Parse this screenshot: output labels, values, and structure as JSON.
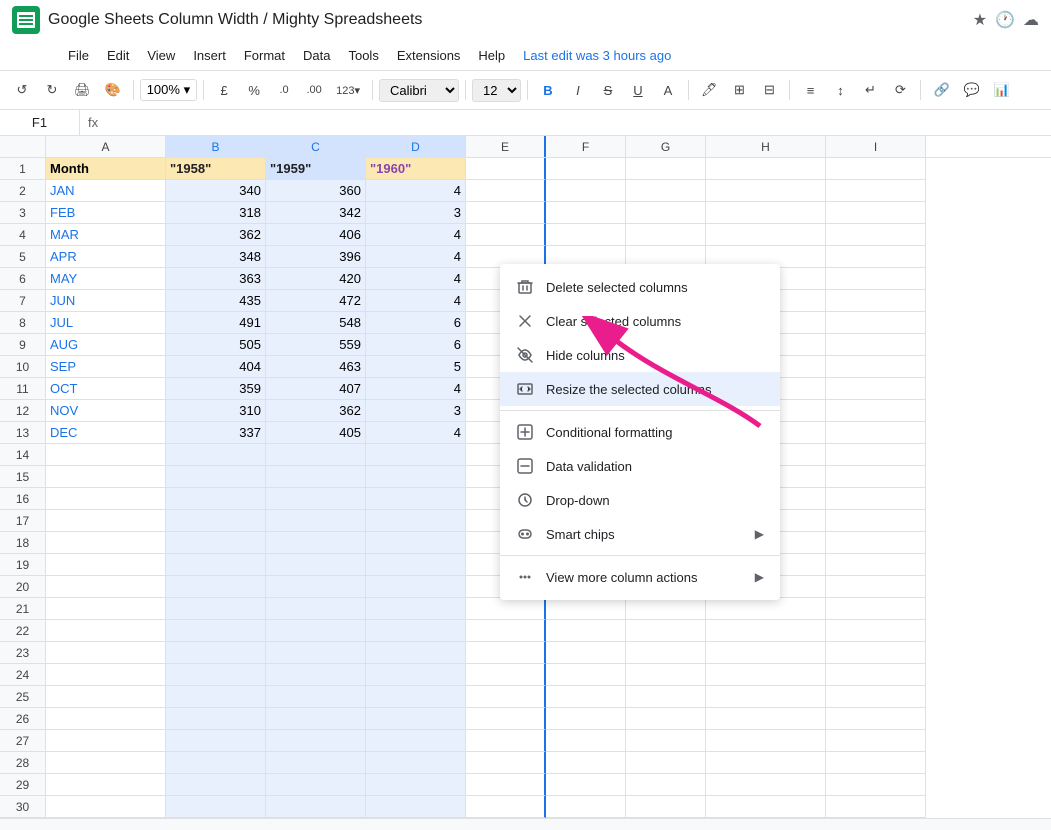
{
  "titleBar": {
    "appName": "Google Sheets",
    "docTitle": "Google Sheets Column Width / Mighty Spreadsheets",
    "starIcon": "★",
    "historyIcon": "🕐",
    "cloudIcon": "☁",
    "lastEdit": "Last edit was 3 hours ago"
  },
  "menuBar": {
    "items": [
      "File",
      "Edit",
      "View",
      "Insert",
      "Format",
      "Data",
      "Tools",
      "Extensions",
      "Help"
    ]
  },
  "toolbar": {
    "undoLabel": "↺",
    "redoLabel": "↻",
    "printLabel": "🖨",
    "paintLabel": "🎨",
    "zoom": "100%",
    "currency": "£",
    "percent": "%",
    "decimal1": ".0",
    "decimal2": ".00",
    "format123": "123",
    "font": "Calibri",
    "fontSize": "12",
    "boldLabel": "B",
    "italicLabel": "I",
    "strikeLabel": "S",
    "underlineLabel": "U",
    "fillLabel": "A",
    "borderLabel": "⊞",
    "mergeLabel": "⊟",
    "alignHLabel": "≡",
    "alignVLabel": "↕",
    "wrapLabel": "↩",
    "rotateLabel": "⟳",
    "linkLabel": "🔗",
    "commentLabel": "💬",
    "chartLabel": "📊"
  },
  "formulaBar": {
    "cellRef": "F1",
    "fx": "fx"
  },
  "columns": {
    "headers": [
      "A",
      "B",
      "C",
      "D",
      "E",
      "F",
      "G",
      "H",
      "I"
    ],
    "widths": [
      120,
      100,
      100,
      100,
      80,
      80,
      80,
      120,
      100
    ]
  },
  "spreadsheet": {
    "rows": [
      [
        "Month",
        "\"1958\"",
        "\"1959\"",
        "\"1960\"",
        "",
        "",
        "",
        "",
        ""
      ],
      [
        "JAN",
        "340",
        "360",
        "4",
        "",
        "",
        "",
        "",
        ""
      ],
      [
        "FEB",
        "318",
        "342",
        "3",
        "",
        "",
        "",
        "",
        ""
      ],
      [
        "MAR",
        "362",
        "406",
        "4",
        "",
        "",
        "",
        "",
        ""
      ],
      [
        "APR",
        "348",
        "396",
        "4",
        "",
        "",
        "",
        "",
        ""
      ],
      [
        "MAY",
        "363",
        "420",
        "4",
        "",
        "",
        "",
        "",
        ""
      ],
      [
        "JUN",
        "435",
        "472",
        "4",
        "",
        "",
        "",
        "",
        ""
      ],
      [
        "JUL",
        "491",
        "548",
        "6",
        "",
        "",
        "",
        "",
        ""
      ],
      [
        "AUG",
        "505",
        "559",
        "6",
        "",
        "",
        "",
        "",
        ""
      ],
      [
        "SEP",
        "404",
        "463",
        "5",
        "",
        "",
        "",
        "",
        ""
      ],
      [
        "OCT",
        "359",
        "407",
        "4",
        "",
        "",
        "",
        "",
        ""
      ],
      [
        "NOV",
        "310",
        "362",
        "3",
        "",
        "",
        "",
        "",
        ""
      ],
      [
        "DEC",
        "337",
        "405",
        "4",
        "",
        "",
        "",
        "",
        ""
      ],
      [
        "",
        "",
        "",
        "",
        "",
        "",
        "",
        "",
        ""
      ],
      [
        "",
        "",
        "",
        "",
        "",
        "",
        "",
        "",
        ""
      ],
      [
        "",
        "",
        "",
        "",
        "",
        "",
        "",
        "",
        ""
      ],
      [
        "",
        "",
        "",
        "",
        "",
        "",
        "",
        "",
        ""
      ],
      [
        "",
        "",
        "",
        "",
        "",
        "",
        "",
        "",
        ""
      ],
      [
        "",
        "",
        "",
        "",
        "",
        "",
        "",
        "",
        ""
      ],
      [
        "",
        "",
        "",
        "",
        "",
        "",
        "",
        "",
        ""
      ],
      [
        "",
        "",
        "",
        "",
        "",
        "",
        "",
        "",
        ""
      ],
      [
        "",
        "",
        "",
        "",
        "",
        "",
        "",
        "",
        ""
      ],
      [
        "",
        "",
        "",
        "",
        "",
        "",
        "",
        "",
        ""
      ],
      [
        "",
        "",
        "",
        "",
        "",
        "",
        "",
        "",
        ""
      ],
      [
        "",
        "",
        "",
        "",
        "",
        "",
        "",
        "",
        ""
      ],
      [
        "",
        "",
        "",
        "",
        "",
        "",
        "",
        "",
        ""
      ],
      [
        "",
        "",
        "",
        "",
        "",
        "",
        "",
        "",
        ""
      ],
      [
        "",
        "",
        "",
        "",
        "",
        "",
        "",
        "",
        ""
      ],
      [
        "",
        "",
        "",
        "",
        "",
        "",
        "",
        "",
        ""
      ]
    ]
  },
  "contextMenu": {
    "items": [
      {
        "icon": "trash",
        "label": "Delete selected columns",
        "hasArrow": false
      },
      {
        "icon": "x",
        "label": "Clear selected columns",
        "hasArrow": false
      },
      {
        "icon": "eye-off",
        "label": "Hide columns",
        "hasArrow": false
      },
      {
        "icon": "resize",
        "label": "Resize the selected columns",
        "hasArrow": false,
        "highlighted": true
      },
      {
        "icon": "format",
        "label": "Conditional formatting",
        "hasArrow": false
      },
      {
        "icon": "validate",
        "label": "Data validation",
        "hasArrow": false
      },
      {
        "icon": "dropdown",
        "label": "Drop-down",
        "hasArrow": false
      },
      {
        "icon": "chip",
        "label": "Smart chips",
        "hasArrow": true
      },
      {
        "icon": "more",
        "label": "View more column actions",
        "hasArrow": true
      }
    ],
    "separatorAfter": [
      3,
      7
    ]
  }
}
